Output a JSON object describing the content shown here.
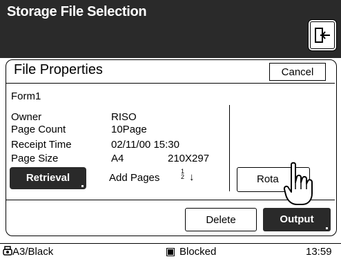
{
  "header": {
    "title": "Storage File Selection",
    "exit_icon": "exit-door-icon"
  },
  "dialog": {
    "title": "File Properties",
    "cancel_label": "Cancel",
    "file_name": "Form1",
    "properties": [
      {
        "label": "Owner",
        "value": "RISO"
      },
      {
        "label": "Page Count",
        "value": "10Page"
      },
      {
        "label": "Receipt Time",
        "value": "02/11/00 15:30"
      },
      {
        "label": "Page Size",
        "value": "A4",
        "extra": "210X297"
      }
    ],
    "retrieval_label": "Retrieval",
    "add_pages_label": "Add Pages",
    "add_pages_top": "1",
    "add_pages_bottom": "2",
    "add_pages_arrow": "↓",
    "rotate_label": "Rota",
    "delete_label": "Delete",
    "output_label": "Output"
  },
  "status": {
    "paper": "A3/Black",
    "blocked": "Blocked",
    "time": "13:59"
  },
  "colors": {
    "dark": "#2a2a2a",
    "light": "#ffffff"
  }
}
